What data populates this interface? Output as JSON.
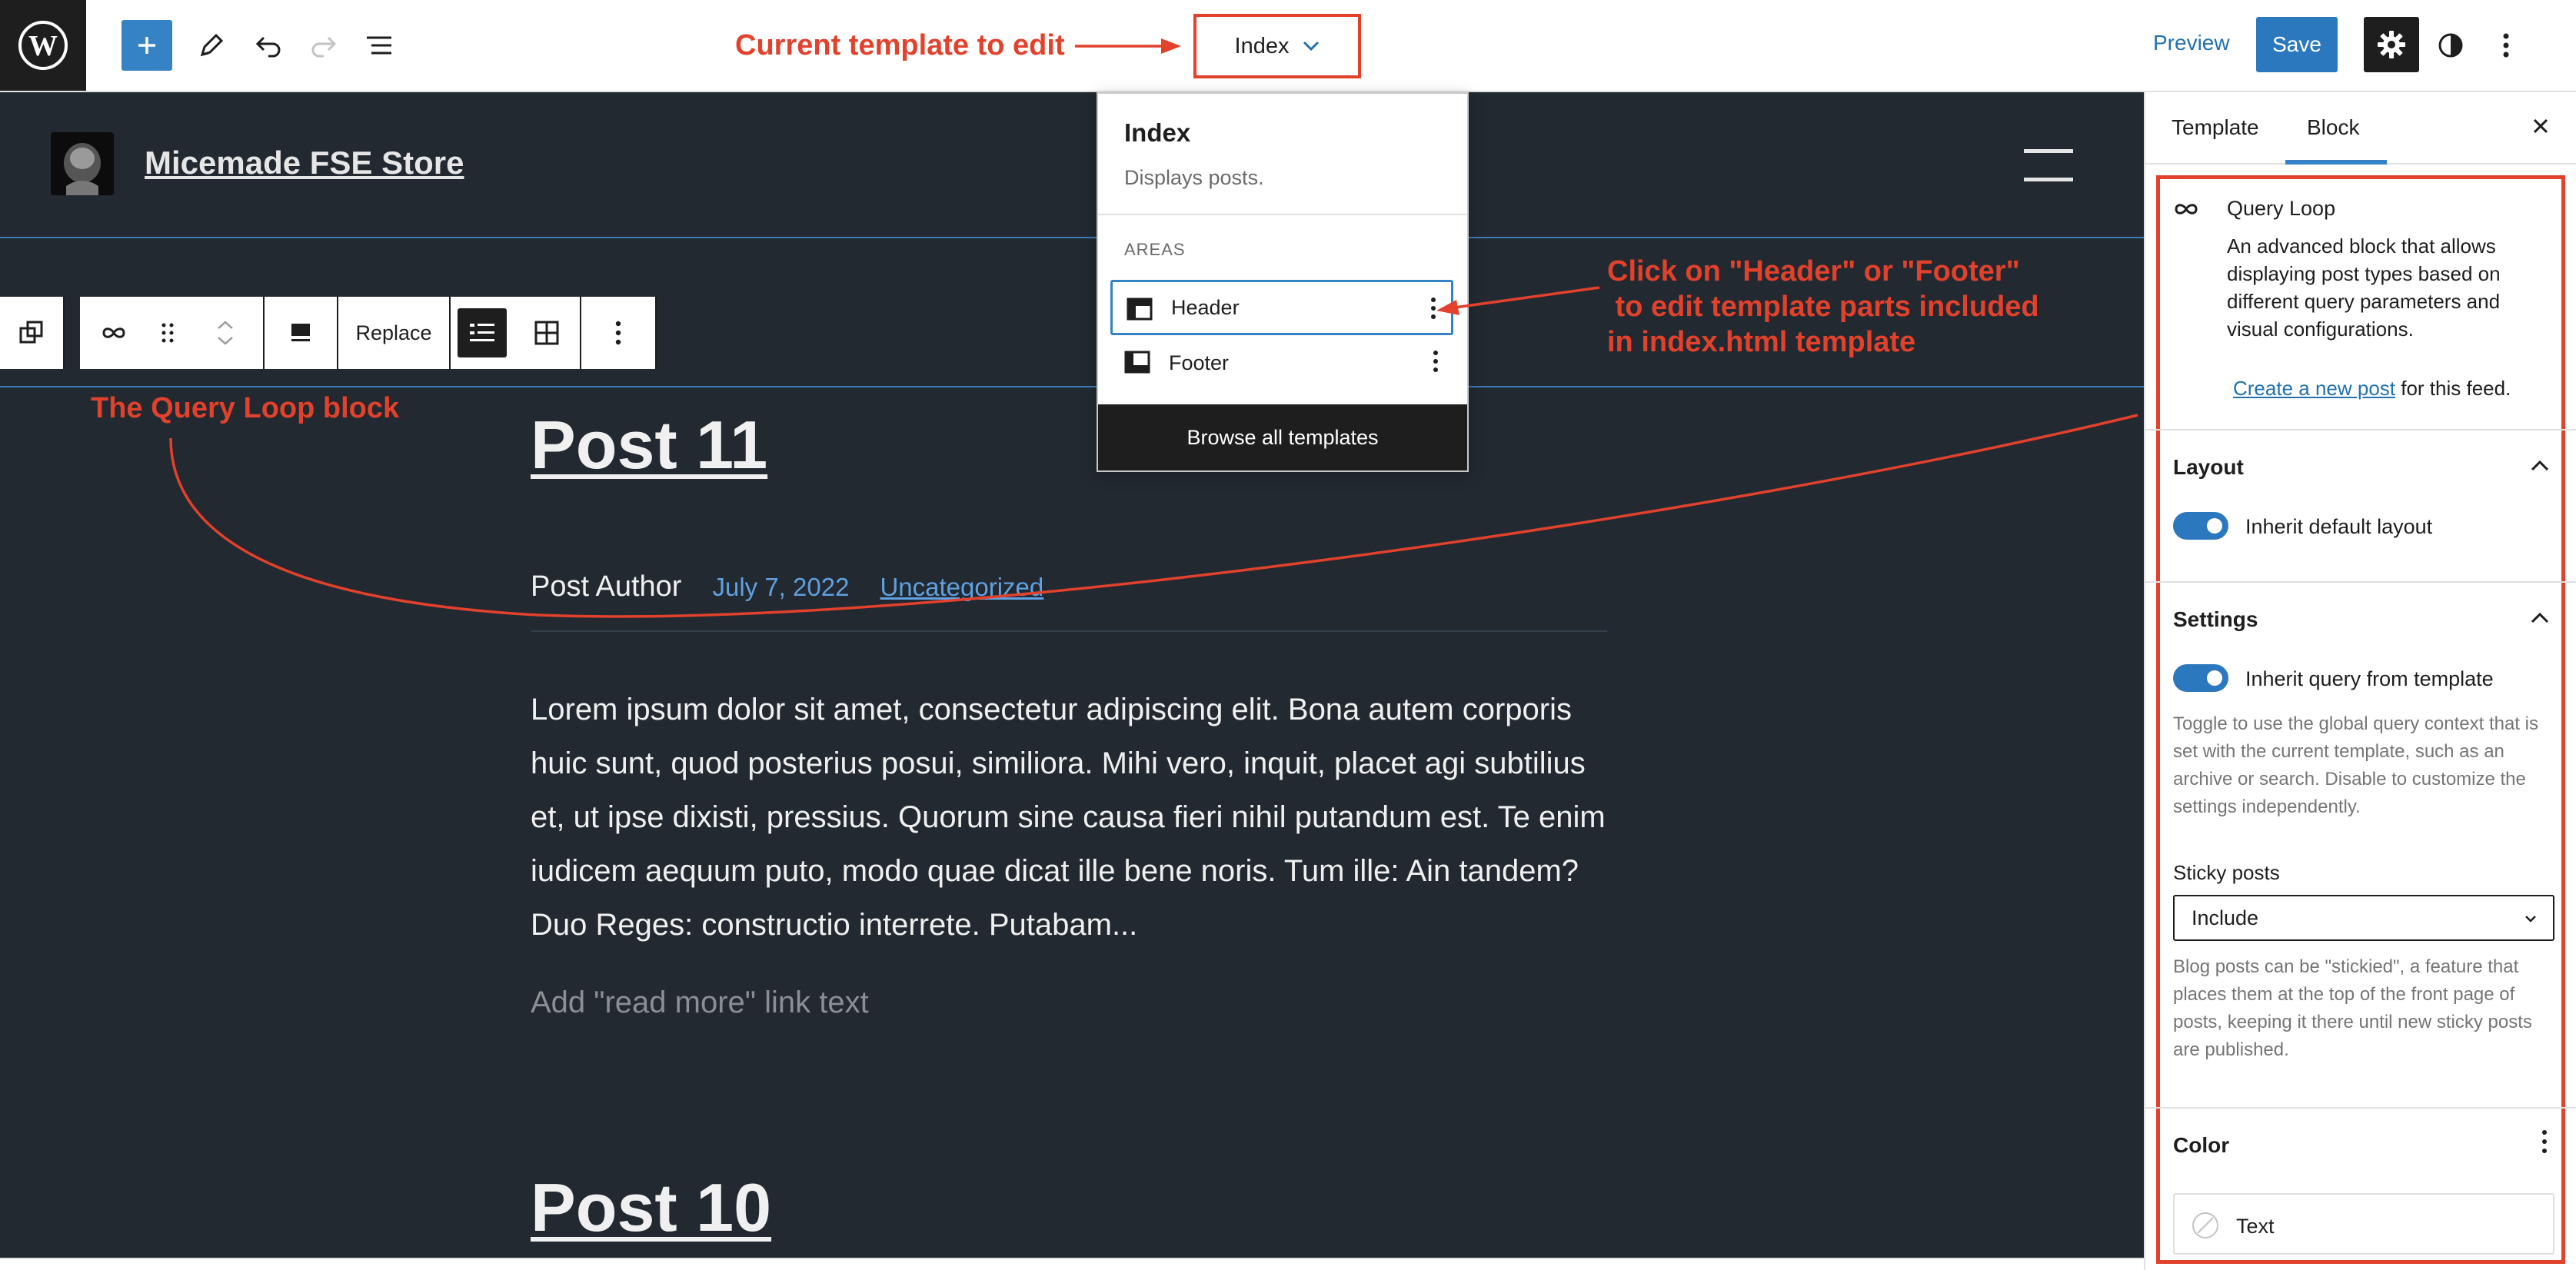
{
  "topbar": {
    "template_name": "Index",
    "preview_label": "Preview",
    "save_label": "Save"
  },
  "annotations": {
    "current_template": "Current template to edit",
    "click_header_footer": [
      "Click on \"Header\" or \"Footer\"",
      " to edit template parts included",
      "in index.html template"
    ],
    "query_loop_block": "The Query Loop block"
  },
  "site": {
    "title": "Micemade FSE Store"
  },
  "block_toolbar": {
    "replace_label": "Replace"
  },
  "posts": [
    {
      "title": "Post 11",
      "author": "Post Author",
      "date": "July 7, 2022",
      "category": "Uncategorized",
      "excerpt": "Lorem ipsum dolor sit amet, consectetur adipiscing elit. Bona autem corporis huic sunt, quod posterius posui, similiora. Mihi vero, inquit, placet agi subtilius et, ut ipse dixisti, pressius. Quorum sine causa fieri nihil putandum est. Te enim iudicem aequum puto, modo quae dicat ille bene noris. Tum ille: Ain tandem? Duo Reges: constructio interrete. Putabam...",
      "read_more_placeholder": "Add \"read more\" link text"
    },
    {
      "title": "Post 10"
    }
  ],
  "template_dropdown": {
    "title": "Index",
    "description": "Displays posts.",
    "areas_heading": "AREAS",
    "areas": [
      {
        "label": "Header"
      },
      {
        "label": "Footer"
      }
    ],
    "browse_label": "Browse all templates"
  },
  "sidebar": {
    "tabs": [
      {
        "label": "Template"
      },
      {
        "label": "Block"
      }
    ],
    "block_name": "Query Loop",
    "block_description": "An advanced block that allows displaying post types based on different query parameters and visual configurations.",
    "create_link_text": "Create a new post",
    "create_link_suffix": " for this feed.",
    "layout": {
      "title": "Layout",
      "toggle_label": "Inherit default layout",
      "toggle_on": true
    },
    "settings": {
      "title": "Settings",
      "toggle_label": "Inherit query from template",
      "toggle_on": true,
      "toggle_help": "Toggle to use the global query context that is set with the current template, such as an archive or search. Disable to customize the settings independently.",
      "sticky_label": "Sticky posts",
      "sticky_value": "Include",
      "sticky_help": "Blog posts can be \"stickied\", a feature that places them at the top of the front page of posts, keeping it there until new sticky posts are published."
    },
    "color": {
      "title": "Color",
      "text_item": "Text"
    }
  },
  "colors": {
    "accent": "#3582c4",
    "annotation": "#e2412c",
    "canvas_bg": "#222930"
  }
}
